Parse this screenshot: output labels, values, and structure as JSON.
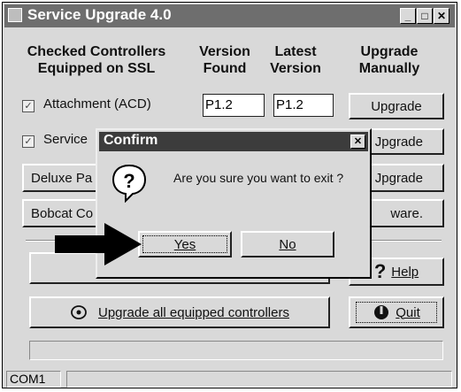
{
  "window": {
    "title": "Service Upgrade 4.0",
    "minimize_icon": "minimize-icon",
    "maximize_icon": "maximize-icon",
    "close_icon": "close-icon"
  },
  "headers": {
    "controllers_line1": "Checked Controllers",
    "controllers_line2": "Equipped on SSL",
    "version_found_line1": "Version",
    "version_found_line2": "Found",
    "latest_line1": "Latest",
    "latest_line2": "Version",
    "upgrade_line1": "Upgrade",
    "upgrade_line2": "Manually"
  },
  "rows": [
    {
      "checked": true,
      "label": "Attachment (ACD)",
      "version_found": "P1.2",
      "latest_version": "P1.2",
      "button": "Upgrade"
    },
    {
      "checked": true,
      "label": "Service",
      "button": "Jpgrade"
    }
  ],
  "partial_rows": [
    {
      "label": "Deluxe Pa",
      "button": "Jpgrade"
    },
    {
      "label": "Bobcat Co",
      "suffix": "ware."
    }
  ],
  "buttons": {
    "help_label": "Help",
    "help_icon": "question-mark-icon",
    "upgrade_all_label": "Upgrade all equipped controllers",
    "upgrade_all_icon": "controller-icon",
    "quit_label": "Quit",
    "quit_icon": "power-icon"
  },
  "status": {
    "port": "COM1"
  },
  "dialog": {
    "title": "Confirm",
    "message": "Are you sure you want to exit ?",
    "icon": "question-icon",
    "yes_label": "Yes",
    "no_label": "No",
    "pointer": "arrow-pointer-icon"
  }
}
